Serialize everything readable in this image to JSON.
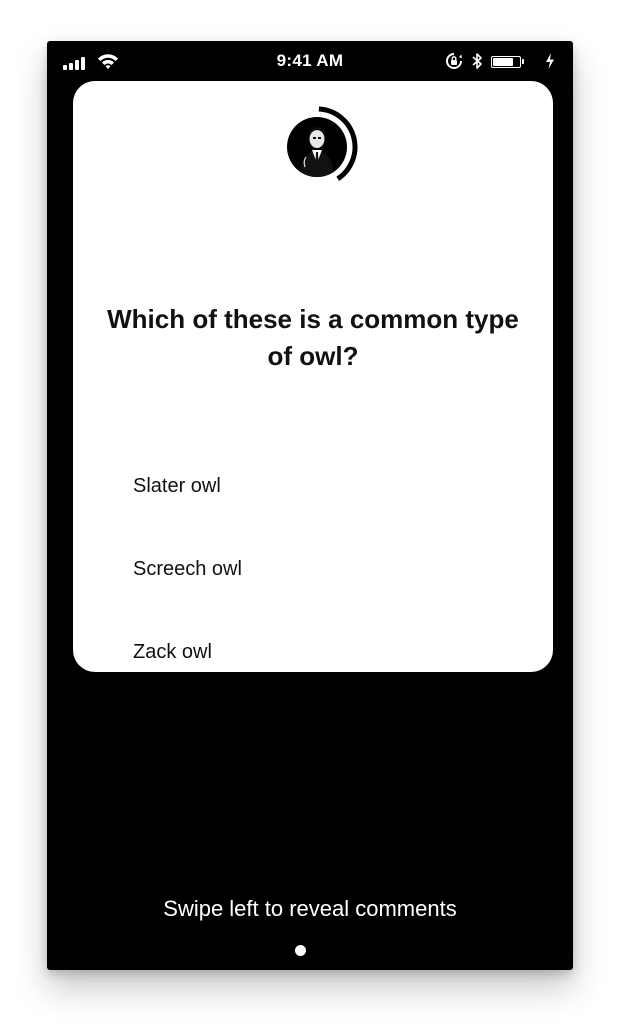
{
  "status_bar": {
    "time": "9:41 AM",
    "signal_icon": "cellular-signal-icon",
    "wifi_icon": "wifi-icon",
    "rotation_lock_icon": "rotation-lock-icon",
    "bluetooth_icon": "bluetooth-icon",
    "battery_icon": "battery-icon",
    "charging_icon": "charging-bolt-icon",
    "battery_level": 0.82
  },
  "card": {
    "timer_icon": "countdown-timer-ring-icon",
    "timer_fraction": 0.4,
    "host_avatar_icon": "host-avatar-icon",
    "question": "Which of these is a common type of owl?",
    "answers": [
      "Slater owl",
      "Screech owl",
      "Zack owl"
    ]
  },
  "footer": {
    "swipe_hint": "Swipe left to reveal comments",
    "page_indicator_count": 1,
    "page_indicator_active": 0
  },
  "colors": {
    "background": "#000000",
    "card": "#ffffff",
    "text_primary": "#111111",
    "text_on_dark": "#ffffff"
  }
}
